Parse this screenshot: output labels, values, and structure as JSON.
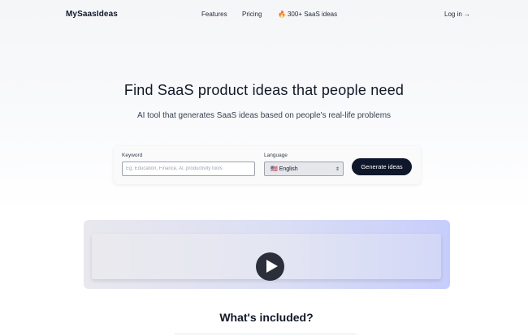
{
  "nav": {
    "logo": "MySaasIdeas",
    "links": [
      {
        "label": "Features"
      },
      {
        "label": "Pricing"
      },
      {
        "label": "300+ SaaS ideas",
        "icon": "fire-icon"
      }
    ],
    "login": "Log in →"
  },
  "hero": {
    "title": "Find SaaS product ideas that people need",
    "subtitle": "AI tool that generates SaaS ideas based on people's real-life problems"
  },
  "form": {
    "keyword_label": "Keyword",
    "keyword_placeholder": "Eg. Education, Finance, AI, productivity tools",
    "keyword_value": "",
    "language_label": "Language",
    "language_selected": "English",
    "language_flag": "🇺🇸",
    "generate_label": "Generate ideas"
  },
  "video": {
    "play_icon": "play-icon"
  },
  "sections": {
    "included_title": "What's included?"
  },
  "colors": {
    "primary_button": "#0f172a",
    "accent_gradient_end": "#c7cdfb"
  }
}
